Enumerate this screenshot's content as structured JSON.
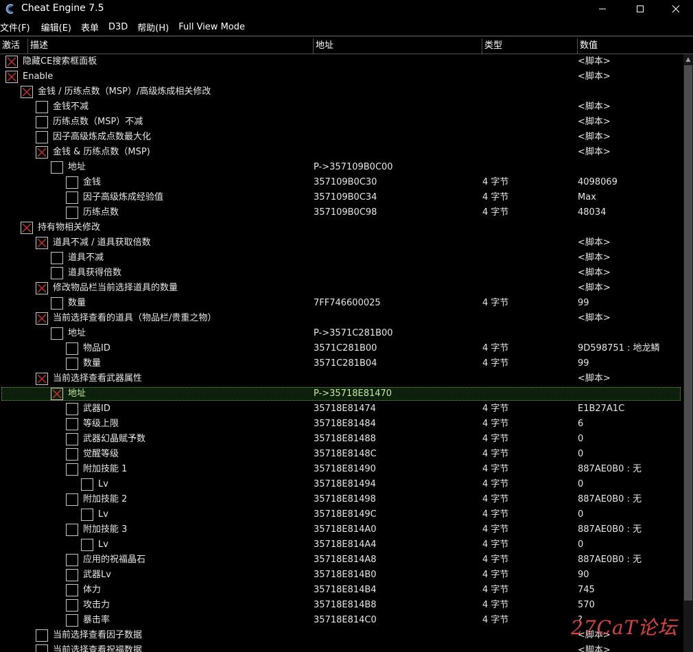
{
  "window": {
    "title": "Cheat Engine 7.5",
    "icon": "cheat-engine-logo-icon"
  },
  "menu": [
    "文件(F)",
    "编辑(E)",
    "表单",
    "D3D",
    "帮助(H)",
    "Full View Mode"
  ],
  "columns": {
    "active": "激活",
    "description": "描述",
    "address": "地址",
    "type": "类型",
    "value": "数值"
  },
  "rows": [
    {
      "level": 0,
      "checked": true,
      "desc": "隐藏CE搜索框面板",
      "addr": "",
      "type": "",
      "value": "<脚本>"
    },
    {
      "level": 0,
      "checked": true,
      "desc": "Enable",
      "addr": "",
      "type": "",
      "value": "<脚本>"
    },
    {
      "level": 1,
      "checked": true,
      "desc": "金钱 / 历练点数（MSP）/高级炼成相关修改",
      "addr": "",
      "type": "",
      "value": ""
    },
    {
      "level": 2,
      "checked": false,
      "desc": "金钱不减",
      "addr": "",
      "type": "",
      "value": "<脚本>"
    },
    {
      "level": 2,
      "checked": false,
      "desc": "历练点数（MSP）不减",
      "addr": "",
      "type": "",
      "value": "<脚本>"
    },
    {
      "level": 2,
      "checked": false,
      "desc": "因子高级炼成点数最大化",
      "addr": "",
      "type": "",
      "value": "<脚本>"
    },
    {
      "level": 2,
      "checked": true,
      "desc": "金钱 & 历练点数（MSP)",
      "addr": "",
      "type": "",
      "value": "<脚本>"
    },
    {
      "level": 3,
      "checked": false,
      "desc": "地址",
      "addr": "P->357109B0C00",
      "type": "",
      "value": ""
    },
    {
      "level": 4,
      "checked": false,
      "desc": "金钱",
      "addr": "357109B0C30",
      "type": "4 字节",
      "value": "4098069"
    },
    {
      "level": 4,
      "checked": false,
      "desc": "因子高级炼成经验值",
      "addr": "357109B0C34",
      "type": "4 字节",
      "value": "Max"
    },
    {
      "level": 4,
      "checked": false,
      "desc": "历练点数",
      "addr": "357109B0C98",
      "type": "4 字节",
      "value": "48034"
    },
    {
      "level": 1,
      "checked": true,
      "desc": "持有物相关修改",
      "addr": "",
      "type": "",
      "value": ""
    },
    {
      "level": 2,
      "checked": true,
      "desc": "道具不减 / 道具获取倍数",
      "addr": "",
      "type": "",
      "value": "<脚本>"
    },
    {
      "level": 3,
      "checked": false,
      "desc": "道具不减",
      "addr": "",
      "type": "",
      "value": "<脚本>"
    },
    {
      "level": 3,
      "checked": false,
      "desc": "道具获得倍数",
      "addr": "",
      "type": "",
      "value": "<脚本>"
    },
    {
      "level": 2,
      "checked": true,
      "desc": "修改物品栏当前选择道具的数量",
      "addr": "",
      "type": "",
      "value": "<脚本>"
    },
    {
      "level": 3,
      "checked": false,
      "desc": "数量",
      "addr": "7FF746600025",
      "type": "4 字节",
      "value": "99"
    },
    {
      "level": 2,
      "checked": true,
      "desc": "当前选择查看的道具（物品栏/贵重之物）",
      "addr": "",
      "type": "",
      "value": "<脚本>"
    },
    {
      "level": 3,
      "checked": false,
      "desc": "地址",
      "addr": "P->3571C281B00",
      "type": "",
      "value": ""
    },
    {
      "level": 4,
      "checked": false,
      "desc": "物品ID",
      "addr": "3571C281B00",
      "type": "4 字节",
      "value": "9D598751 : 地龙鳞"
    },
    {
      "level": 4,
      "checked": false,
      "desc": "数量",
      "addr": "3571C281B04",
      "type": "4 字节",
      "value": "99"
    },
    {
      "level": 2,
      "checked": true,
      "desc": "当前选择查看武器属性",
      "addr": "",
      "type": "",
      "value": "<脚本>"
    },
    {
      "level": 3,
      "checked": true,
      "selected": true,
      "desc": "地址",
      "addr": "P->35718E81470",
      "type": "",
      "value": ""
    },
    {
      "level": 4,
      "checked": false,
      "desc": "武器ID",
      "addr": "35718E81474",
      "type": "4 字节",
      "value": "E1B27A1C"
    },
    {
      "level": 4,
      "checked": false,
      "desc": "等级上限",
      "addr": "35718E81484",
      "type": "4 字节",
      "value": "6"
    },
    {
      "level": 4,
      "checked": false,
      "desc": "武器幻晶赋予数",
      "addr": "35718E81488",
      "type": "4 字节",
      "value": "0"
    },
    {
      "level": 4,
      "checked": false,
      "desc": "觉醒等级",
      "addr": "35718E8148C",
      "type": "4 字节",
      "value": "0"
    },
    {
      "level": 4,
      "checked": false,
      "desc": "附加技能 1",
      "addr": "35718E81490",
      "type": "4 字节",
      "value": "887AE0B0 : 无"
    },
    {
      "level": 5,
      "checked": false,
      "desc": "Lv",
      "addr": "35718E81494",
      "type": "4 字节",
      "value": "0"
    },
    {
      "level": 4,
      "checked": false,
      "desc": "附加技能 2",
      "addr": "35718E81498",
      "type": "4 字节",
      "value": "887AE0B0 : 无"
    },
    {
      "level": 5,
      "checked": false,
      "desc": "Lv",
      "addr": "35718E8149C",
      "type": "4 字节",
      "value": "0"
    },
    {
      "level": 4,
      "checked": false,
      "desc": "附加技能 3",
      "addr": "35718E814A0",
      "type": "4 字节",
      "value": "887AE0B0 : 无"
    },
    {
      "level": 5,
      "checked": false,
      "desc": "Lv",
      "addr": "35718E814A4",
      "type": "4 字节",
      "value": "0"
    },
    {
      "level": 4,
      "checked": false,
      "desc": "应用的祝福晶石",
      "addr": "35718E814A8",
      "type": "4 字节",
      "value": "887AE0B0 : 无"
    },
    {
      "level": 4,
      "checked": false,
      "desc": "武器Lv",
      "addr": "35718E814B0",
      "type": "4 字节",
      "value": "90"
    },
    {
      "level": 4,
      "checked": false,
      "desc": "体力",
      "addr": "35718E814B4",
      "type": "4 字节",
      "value": "745"
    },
    {
      "level": 4,
      "checked": false,
      "desc": "攻击力",
      "addr": "35718E814B8",
      "type": "4 字节",
      "value": "570"
    },
    {
      "level": 4,
      "checked": false,
      "desc": "暴击率",
      "addr": "35718E814C0",
      "type": "4 字节",
      "value": "?"
    },
    {
      "level": 2,
      "checked": false,
      "desc": "当前选择查看因子数据",
      "addr": "",
      "type": "",
      "value": "<脚本>"
    },
    {
      "level": 2,
      "checked": false,
      "desc": "当前选择查看祝福数据",
      "addr": "",
      "type": "",
      "value": "<脚本>"
    }
  ],
  "watermark": "27CaT论坛",
  "colors": {
    "background": "#000000",
    "text": "#e6e6e6",
    "selection_border": "#6fa53a",
    "check_mark": "#d0312d"
  }
}
